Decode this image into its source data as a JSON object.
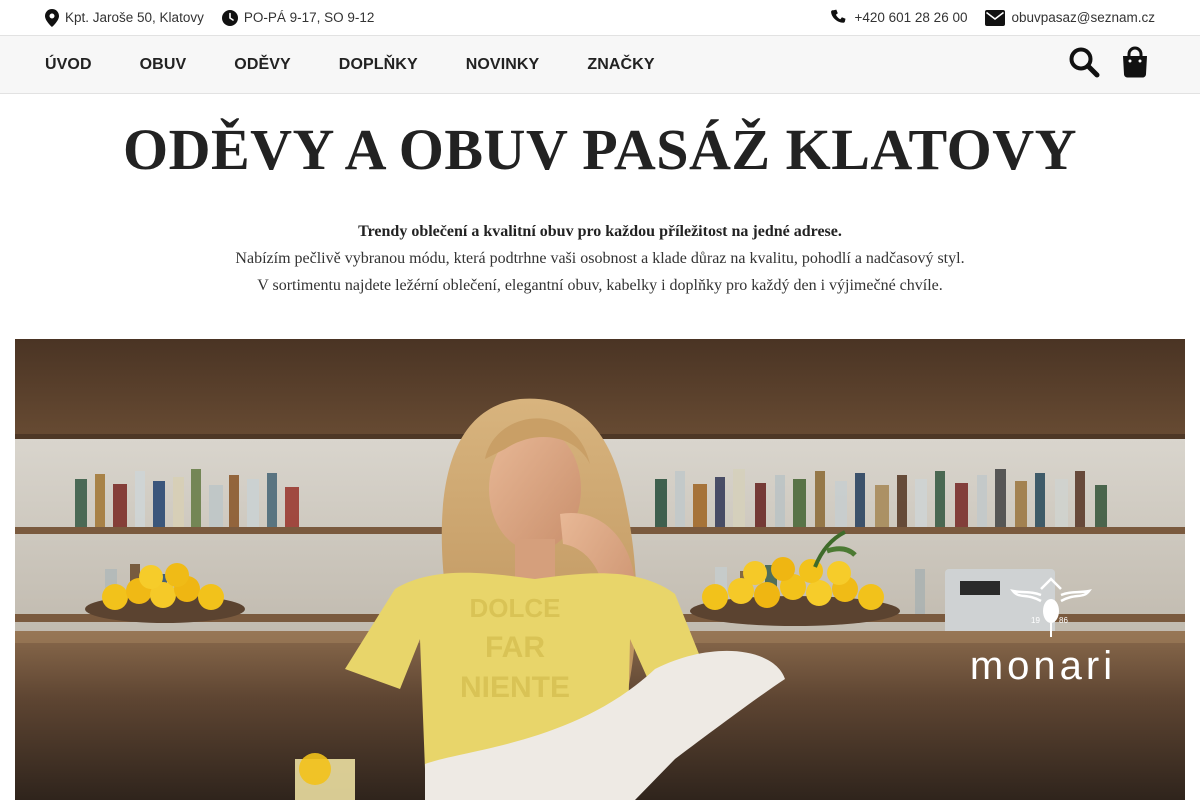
{
  "topbar": {
    "address": "Kpt. Jaroše 50, Klatovy",
    "hours": "PO-PÁ 9-17, SO 9-12",
    "phone": "+420 601 28 26 00",
    "email": "obuvpasaz@seznam.cz",
    "icons": [
      "map-pin-icon",
      "clock-icon",
      "phone-icon",
      "envelope-icon"
    ]
  },
  "nav": {
    "items": [
      {
        "label": "ÚVOD"
      },
      {
        "label": "OBUV"
      },
      {
        "label": "ODĚVY"
      },
      {
        "label": "DOPLŇKY"
      },
      {
        "label": "NOVINKY"
      },
      {
        "label": "ZNAČKY"
      }
    ],
    "icons": [
      "search-icon",
      "shopping-bag-icon"
    ]
  },
  "hero": {
    "title": "ODĚVY A OBUV PASÁŽ KLATOVY",
    "lead": "Trendy oblečení a kvalitní obuv pro každou příležitost na jedné adrese.",
    "line2": "Nabízím pečlivě vybranou módu, která podtrhne vaši osobnost a klade důraz na kvalitu, pohodlí a nadčasový styl.",
    "line3": "V sortimentu najdete ležérní oblečení, elegantní obuv, kabelky i doplňky pro každý den i výjimečné chvíle."
  },
  "banner": {
    "brand": "monari",
    "brand_year_left": "19",
    "brand_year_right": "86",
    "shirt_text": [
      "DOLCE",
      "FAR",
      "NIENTE"
    ]
  },
  "colors": {
    "text": "#222222",
    "nav_bg": "#f7f7f7",
    "border": "#e2e2e2",
    "shirt_yellow": "#e8d56a",
    "lemon": "#f2c21b",
    "wood": "#6b4a2f"
  }
}
